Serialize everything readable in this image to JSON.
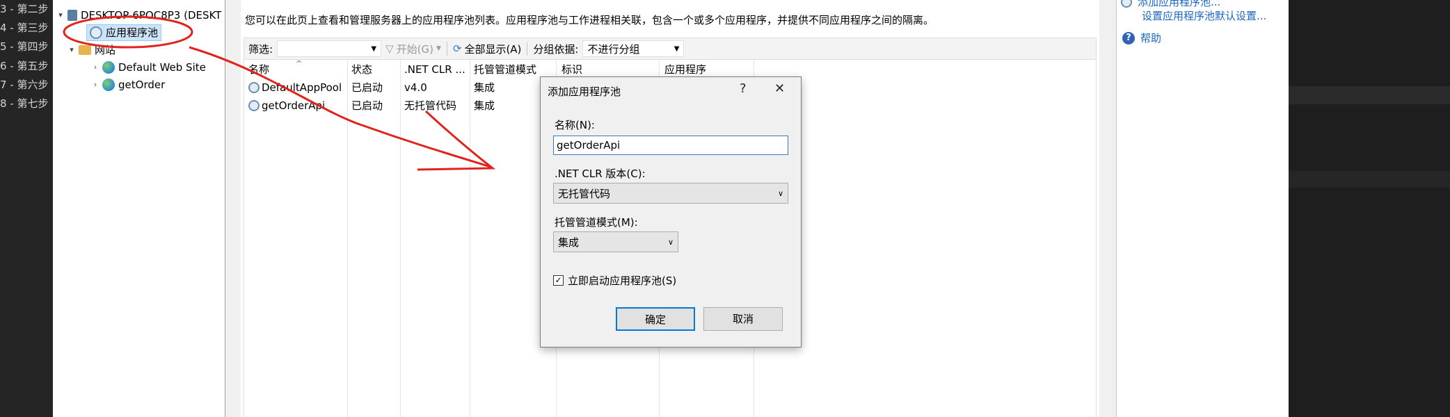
{
  "left_strip": {
    "items": [
      "3 - 第二步",
      "4 - 第三步",
      "5 - 第四步",
      "6 - 第五步",
      "7 - 第六步",
      "8 - 第七步"
    ]
  },
  "tree": {
    "server_label": "DESKTOP-6POC8P3 (DESKT",
    "app_pools_label": "应用程序池",
    "sites_label": "网站",
    "site_items": [
      "Default Web Site",
      "getOrder"
    ]
  },
  "main": {
    "description": "您可以在此页上查看和管理服务器上的应用程序池列表。应用程序池与工作进程相关联，包含一个或多个应用程序，并提供不同应用程序之间的隔离。",
    "toolbar": {
      "filter_label": "筛选:",
      "start_label": "开始(G)",
      "show_all_label": "全部显示(A)",
      "group_by_label": "分组依据:",
      "group_by_value": "不进行分组"
    },
    "columns": [
      "名称",
      "状态",
      ".NET CLR ...",
      "托管管道模式",
      "标识",
      "应用程序"
    ],
    "rows": [
      {
        "name": "DefaultAppPool",
        "status": "已启动",
        "clr": "v4.0",
        "mode": "集成"
      },
      {
        "name": "getOrderApi",
        "status": "已启动",
        "clr": "无托管代码",
        "mode": "集成"
      }
    ]
  },
  "actions": {
    "add_pool": "添加应用程序池...",
    "set_defaults": "设置应用程序池默认设置...",
    "help": "帮助"
  },
  "dialog": {
    "title": "添加应用程序池",
    "help_glyph": "?",
    "close_glyph": "✕",
    "name_label": "名称(N):",
    "name_value": "getOrderApi",
    "clr_label": ".NET CLR 版本(C):",
    "clr_value": "无托管代码",
    "pipeline_label": "托管管道模式(M):",
    "pipeline_value": "集成",
    "start_immediately_label": "立即启动应用程序池(S)",
    "ok_label": "确定",
    "cancel_label": "取消"
  },
  "colors": {
    "annotation_red": "#e0231c",
    "link_blue": "#1a66c2",
    "selection": "#cce4f7"
  }
}
